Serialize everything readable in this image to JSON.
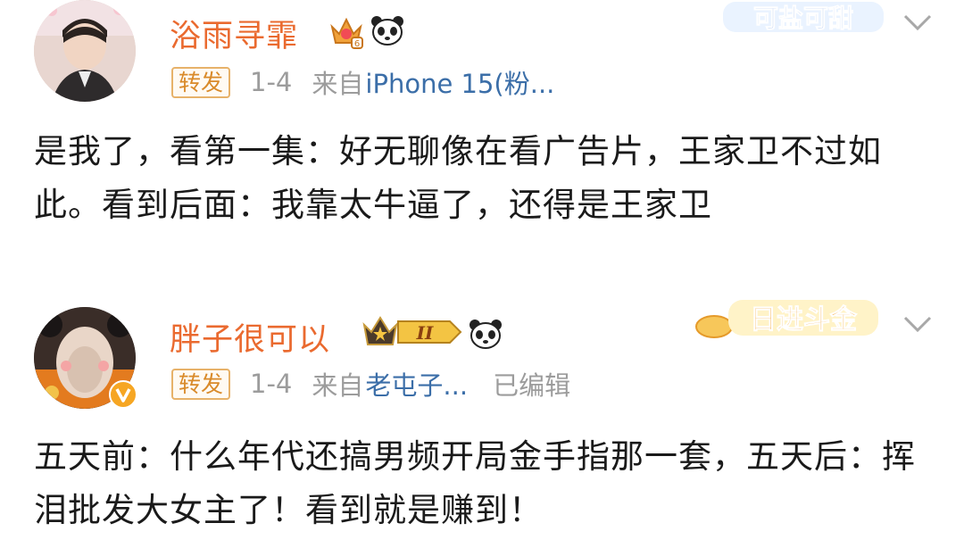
{
  "posts": [
    {
      "username": "浴雨寻霏",
      "badge": "转发",
      "date": "1-4",
      "source_prefix": "来自",
      "device": "iPhone 15(粉...",
      "edited": "",
      "decoration_text": "可盐可甜",
      "content": "是我了，看第一集：好无聊像在看广告片，王家卫不过如此。看到后面：我靠太牛逼了，还得是王家卫"
    },
    {
      "username": "胖子很可以",
      "badge": "转发",
      "date": "1-4",
      "source_prefix": "来自",
      "device": "老屯子...",
      "edited": "已编辑",
      "member_level": "II",
      "decoration_text": "日进斗金",
      "content": "五天前：什么年代还搞男频开局金手指那一套，五天后：挥泪批发大女主了！看到就是赚到！"
    }
  ],
  "colors": {
    "username": "#ea6a2f",
    "meta": "#9c9c9c",
    "device_link": "#3b6ea8",
    "badge_border": "#e7b26a",
    "text": "#1a1a1a"
  }
}
